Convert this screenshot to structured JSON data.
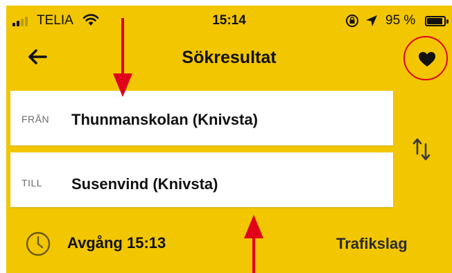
{
  "status_bar": {
    "carrier": "TELIA",
    "time": "15:14",
    "battery_percent": "95 %",
    "battery_level": 0.95
  },
  "nav": {
    "title": "Sökresultat"
  },
  "search": {
    "from_label": "FRÅN",
    "from_value": "Thunmanskolan (Knivsta)",
    "to_label": "TILL",
    "to_value": "Susenvind (Knivsta)"
  },
  "options": {
    "departure": "Avgång 15:13",
    "transport_modes": "Trafikslag"
  },
  "colors": {
    "background": "#f2c600",
    "annotation": "#e0001a"
  },
  "icons": [
    "signal-icon",
    "wifi-icon",
    "rotation-lock-icon",
    "location-arrow-icon",
    "battery-icon",
    "back-arrow-icon",
    "heart-icon",
    "swap-icon",
    "clock-icon"
  ]
}
